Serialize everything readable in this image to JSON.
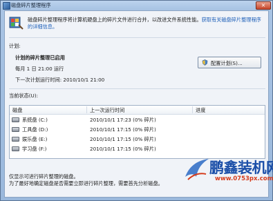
{
  "window": {
    "title": "磁盘碎片整理程序",
    "close_glyph": "×"
  },
  "header": {
    "description": "磁盘碎片整理程序将计算机硬盘上的碎片文件进行合并，以改进文件系统性能。",
    "link_text": "获取有关磁盘碎片整理程序的详细信息。"
  },
  "schedule": {
    "section_label": "计划:",
    "status_title": "计划的碎片整理已启用",
    "frequency": "每月 1 日 21:00 运行",
    "next_run": "下一次计划运行时间: 2010/10/1 21:00",
    "configure_button": "配置计划(S)..."
  },
  "current_status": {
    "section_label": "当前状态(U):",
    "columns": [
      "磁盘",
      "上一次运行时间",
      "进度"
    ],
    "disks": [
      {
        "name": "系统盘 (C:)",
        "last_run": "2010/10/1 17:23 (0% 碎片)",
        "progress": ""
      },
      {
        "name": "工具盘 (D:)",
        "last_run": "2010/10/1 17:15 (0% 碎片)",
        "progress": ""
      },
      {
        "name": "娱乐盘 (E:)",
        "last_run": "2010/10/1 17:15 (0% 碎片)",
        "progress": ""
      },
      {
        "name": "学习盘 (F:)",
        "last_run": "2010/10/1 17:15 (0% 碎片)",
        "progress": ""
      }
    ]
  },
  "footer": {
    "line1": "仅显示可进行碎片整理的磁盘。",
    "line2": "为了最好地确定磁盘是否需要立即进行碎片整理，需要首先分析磁盘。"
  },
  "watermark": {
    "brand": "鹏鑫装机网",
    "url": "www.0753px.com"
  },
  "colors": {
    "accent": "#1d5fb8",
    "watermark_blue": "#1b4fa8",
    "watermark_red": "#d53b1b"
  }
}
